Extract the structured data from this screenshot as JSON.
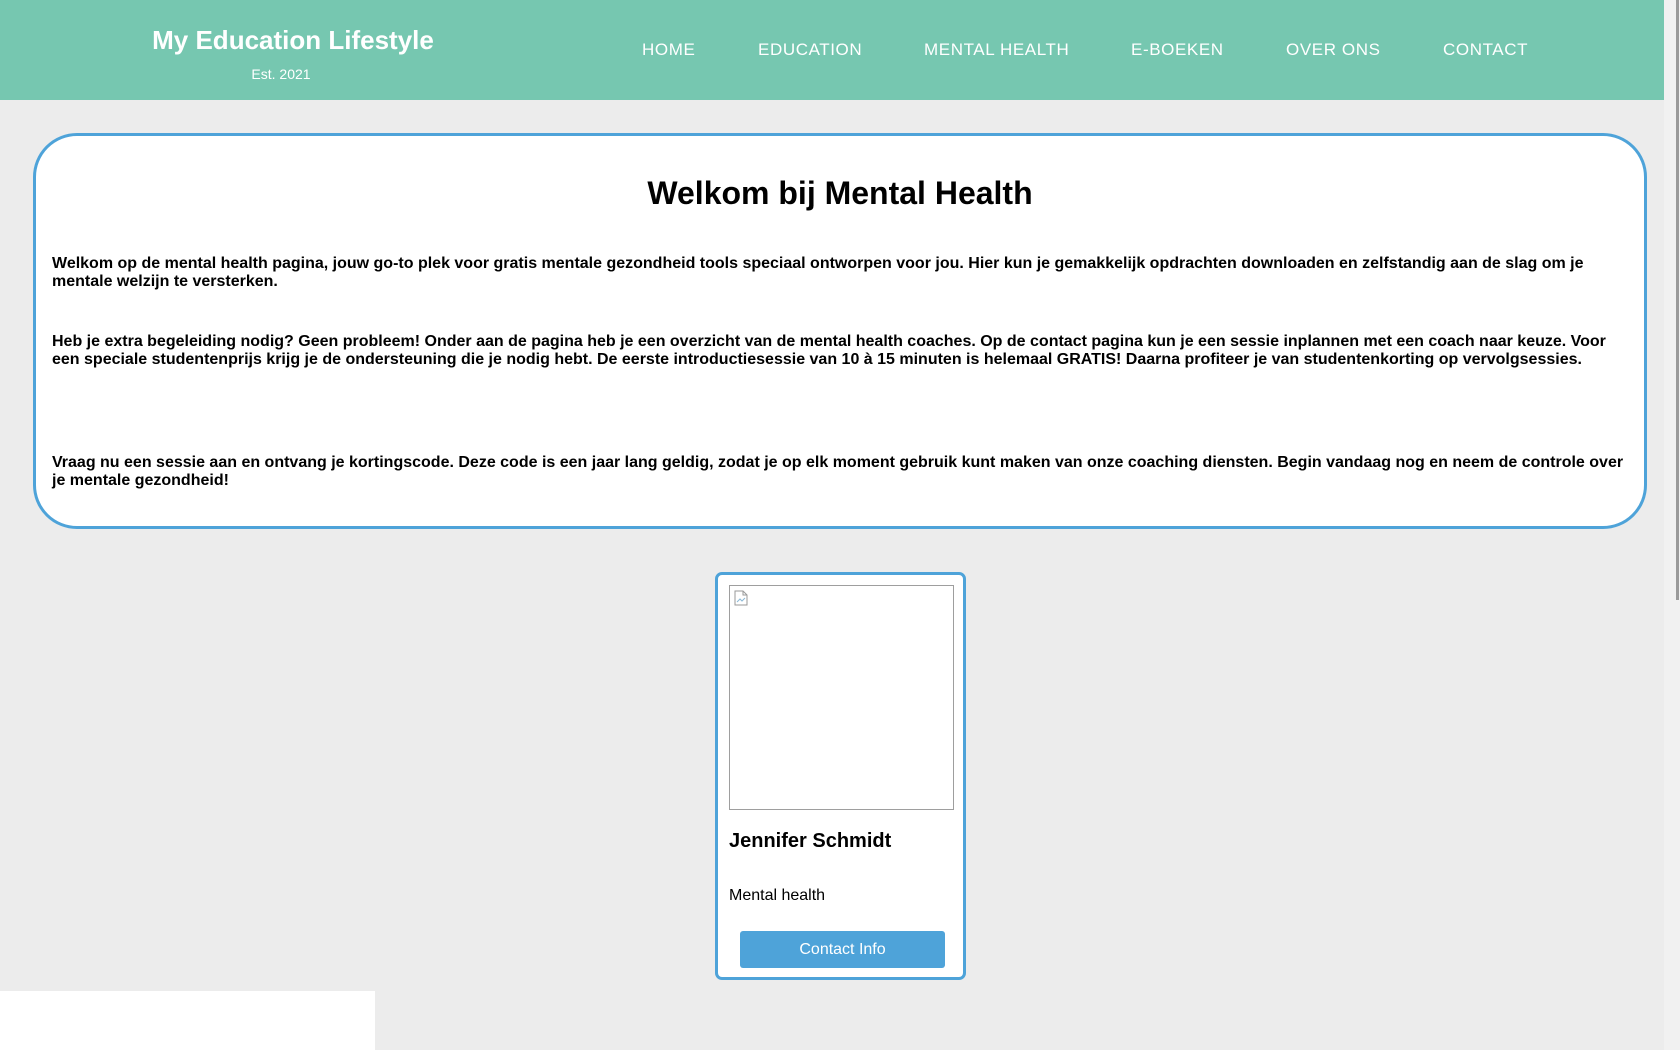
{
  "header": {
    "brand_title": "My Education Lifestyle",
    "brand_subtitle": "Est. 2021",
    "background_color": "#76c7b0",
    "nav": [
      {
        "label": "HOME"
      },
      {
        "label": "EDUCATION"
      },
      {
        "label": "MENTAL HEALTH"
      },
      {
        "label": "E-BOEKEN"
      },
      {
        "label": "OVER ONS"
      },
      {
        "label": "CONTACT"
      }
    ]
  },
  "welcome": {
    "title": "Welkom bij Mental Health",
    "paragraphs": [
      "Welkom op de mental health pagina, jouw go-to plek voor gratis mentale gezondheid tools speciaal ontworpen voor jou. Hier kun je gemakkelijk opdrachten downloaden en zelfstandig aan de slag om je mentale welzijn te versterken.",
      "Heb je extra begeleiding nodig? Geen probleem! Onder aan de pagina heb je een overzicht van de mental health coaches. Op de contact pagina kun je een sessie inplannen met een coach naar keuze. Voor een speciale studentenprijs krijg je de ondersteuning die je nodig hebt. De eerste introductiesessie van 10 à 15 minuten is helemaal GRATIS! Daarna profiteer je van studentenkorting op vervolgsessies.",
      "Vraag nu een sessie aan en ontvang je kortingscode. Deze code is een jaar lang geldig, zodat je op elk moment gebruik kunt maken van onze coaching diensten. Begin vandaag nog en neem de controle over je mentale gezondheid!"
    ],
    "border_color": "#4ea3d9"
  },
  "coach_card": {
    "image_icon": "broken-image-icon",
    "name": "Jennifer Schmidt",
    "role": "Mental health",
    "button_label": "Contact Info",
    "accent_color": "#4ea3d9"
  }
}
